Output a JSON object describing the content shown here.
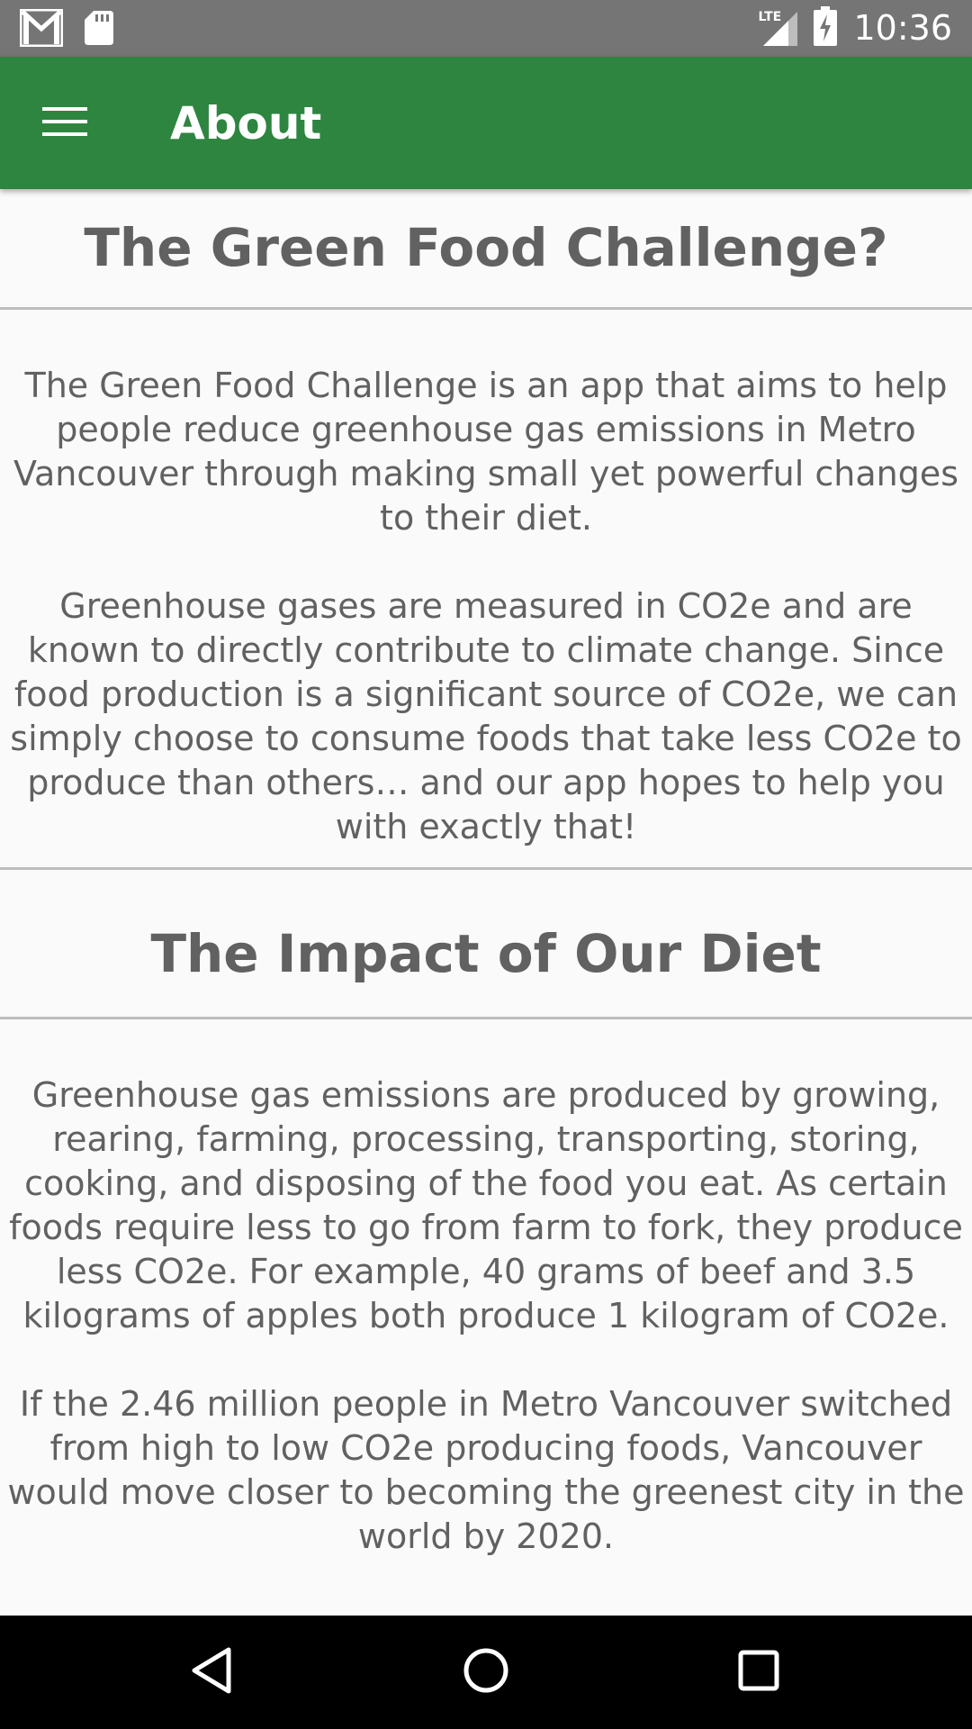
{
  "status_bar": {
    "time": "10:36",
    "network": "LTE",
    "icons": [
      "gmail-icon",
      "sd-card-icon",
      "signal-icon",
      "battery-charging-icon"
    ]
  },
  "app_bar": {
    "title": "About",
    "menu_icon": "hamburger-menu-icon",
    "color": "#2e8540"
  },
  "sections": [
    {
      "title": "The Green Food Challenge?",
      "paragraphs": [
        "The Green Food Challenge is an app that aims to help people reduce greenhouse gas emissions in Metro Vancouver through making small yet powerful changes to their diet.",
        "Greenhouse gases are measured in CO2e and are known to directly contribute to climate change. Since food production is a significant source of CO2e, we can simply choose to consume foods that take less CO2e to produce than others… and our app hopes to help you with exactly that!"
      ]
    },
    {
      "title": "The Impact of Our Diet",
      "paragraphs": [
        "Greenhouse gas emissions are produced by growing, rearing, farming, processing, transporting, storing, cooking, and disposing of the food you eat. As certain foods require less to go from farm to fork, they produce less CO2e. For example, 40 grams of beef and 3.5 kilograms of apples both produce 1 kilogram of CO2e.",
        "If the 2.46 million people in Metro Vancouver switched from high to low CO2e producing foods, Vancouver would move closer to becoming the greenest city in the world by 2020."
      ]
    }
  ],
  "nav_bar": {
    "icons": [
      "back-icon",
      "home-icon",
      "recents-icon"
    ]
  }
}
